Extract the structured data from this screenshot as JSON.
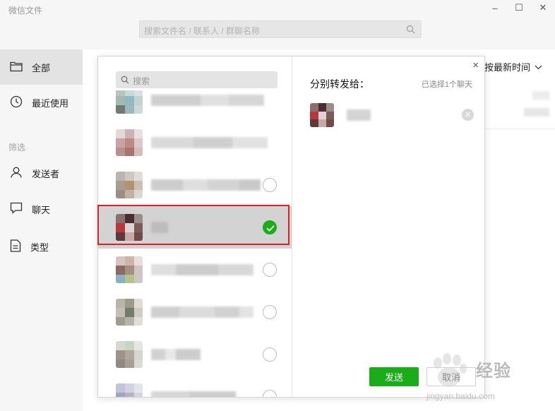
{
  "window": {
    "title": "微信文件",
    "minimize": "–",
    "maximize": "☐",
    "close": "✕"
  },
  "search": {
    "placeholder": "搜索文件名 / 联系人 / 群聊名称"
  },
  "sidebar": {
    "items": [
      {
        "label": "全部",
        "icon": "folder-icon",
        "active": true
      },
      {
        "label": "最近使用",
        "icon": "clock-icon",
        "active": false
      }
    ],
    "filter_label": "筛选",
    "filters": [
      {
        "label": "发送者",
        "icon": "person-icon"
      },
      {
        "label": "聊天",
        "icon": "chat-bubble-icon"
      },
      {
        "label": "类型",
        "icon": "document-icon"
      }
    ]
  },
  "main": {
    "sort_label": "按最新时间"
  },
  "dialog": {
    "search_placeholder": "搜索",
    "close": "×",
    "right_title": "分别转发给：",
    "selected_count": "已选择1个聊天",
    "send_label": "发送",
    "cancel_label": "取消",
    "contacts": [
      {
        "selected": false,
        "checkbox_visible": false
      },
      {
        "selected": false,
        "checkbox_visible": false
      },
      {
        "selected": false,
        "checkbox_visible": true
      },
      {
        "selected": true,
        "checkbox_visible": true
      },
      {
        "selected": false,
        "checkbox_visible": true
      },
      {
        "selected": false,
        "checkbox_visible": true
      },
      {
        "selected": false,
        "checkbox_visible": true
      },
      {
        "selected": false,
        "checkbox_visible": true
      }
    ]
  },
  "watermark": {
    "text": "经验",
    "url": "jingyan.baidu.com"
  },
  "colors": {
    "accent_green": "#1aad19",
    "highlight_red": "#e02020"
  }
}
